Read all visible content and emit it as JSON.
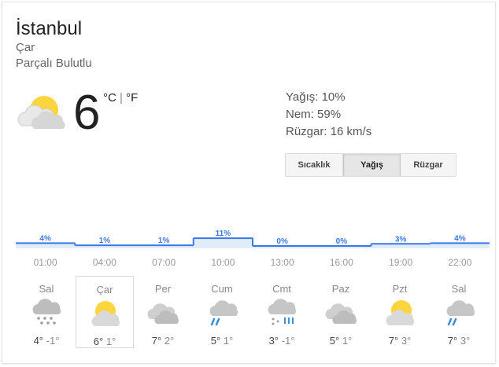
{
  "location": "İstanbul",
  "day": "Çar",
  "condition": "Parçalı Bulutlu",
  "current": {
    "temp": "6",
    "unit_c": "°C",
    "unit_sep": "|",
    "unit_f": "°F",
    "icon": "partly-cloudy-icon"
  },
  "stats": {
    "precip": "Yağış: 10%",
    "humidity": "Nem: 59%",
    "wind": "Rüzgar: 16 km/s"
  },
  "tabs": [
    {
      "label": "Sıcaklık",
      "selected": false
    },
    {
      "label": "Yağış",
      "selected": true
    },
    {
      "label": "Rüzgar",
      "selected": false
    }
  ],
  "chart_data": {
    "type": "area",
    "x": [
      "01:00",
      "04:00",
      "07:00",
      "10:00",
      "13:00",
      "16:00",
      "19:00",
      "22:00"
    ],
    "values": [
      4,
      1,
      1,
      11,
      0,
      0,
      3,
      4
    ],
    "labels": [
      "4%",
      "1%",
      "1%",
      "11%",
      "0%",
      "0%",
      "3%",
      "4%"
    ],
    "color": "#3b78e7",
    "fill": "#e1ecf9"
  },
  "forecast": [
    {
      "day": "Sal",
      "hi": "4°",
      "lo": "-1°",
      "icon": "snow-icon"
    },
    {
      "day": "Çar",
      "hi": "6°",
      "lo": "1°",
      "icon": "partly-cloudy-icon"
    },
    {
      "day": "Per",
      "hi": "7°",
      "lo": "2°",
      "icon": "cloudy-icon"
    },
    {
      "day": "Cum",
      "hi": "5°",
      "lo": "1°",
      "icon": "rain-icon"
    },
    {
      "day": "Cmt",
      "hi": "3°",
      "lo": "-1°",
      "icon": "sleet-icon"
    },
    {
      "day": "Paz",
      "hi": "5°",
      "lo": "1°",
      "icon": "cloudy-icon"
    },
    {
      "day": "Pzt",
      "hi": "7°",
      "lo": "3°",
      "icon": "partly-cloudy-icon"
    },
    {
      "day": "Sal",
      "hi": "7°",
      "lo": "3°",
      "icon": "rain-icon"
    }
  ],
  "selected_day_index": 1
}
